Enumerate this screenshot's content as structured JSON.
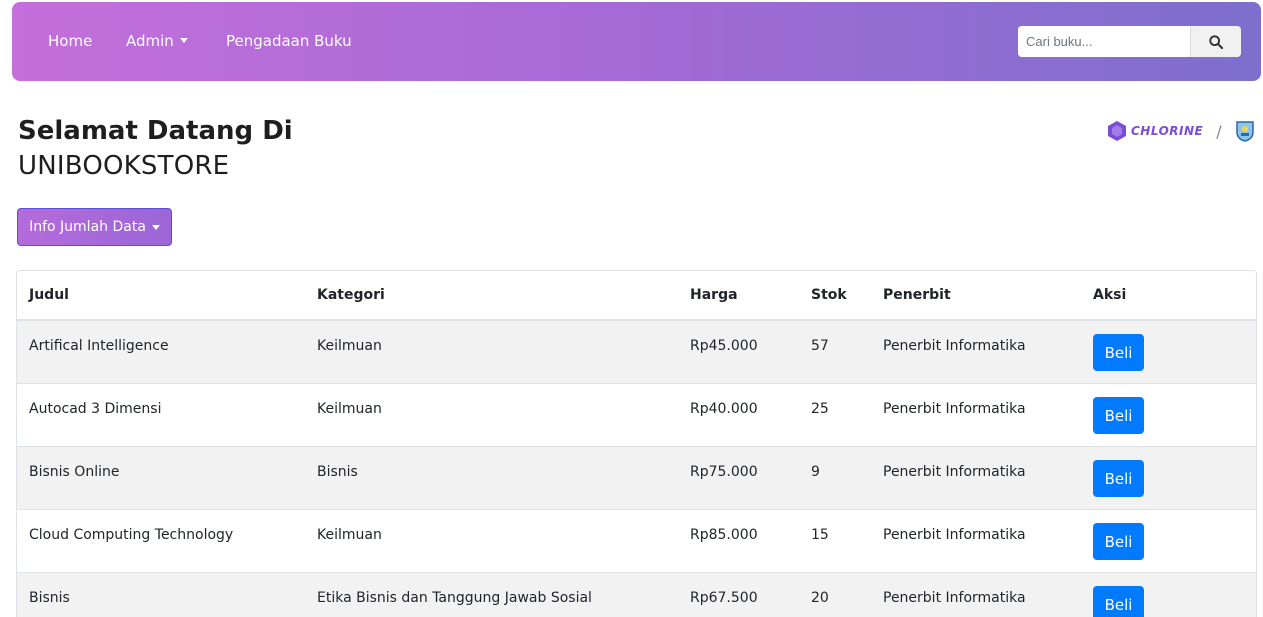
{
  "navbar": {
    "items": [
      {
        "label": "Home"
      },
      {
        "label": "Admin"
      },
      {
        "label": "Pengadaan Buku"
      }
    ],
    "search": {
      "placeholder": "Cari buku..."
    }
  },
  "header": {
    "title_line1": "Selamat Datang Di",
    "title_line2": "UNIBOOKSTORE",
    "logo_text": "CHLORINE",
    "separator": "/"
  },
  "info_button": {
    "label": "Info Jumlah Data"
  },
  "table": {
    "columns": [
      "Judul",
      "Kategori",
      "Harga",
      "Stok",
      "Penerbit",
      "Aksi"
    ],
    "rows": [
      {
        "judul": "Artifical Intelligence",
        "kategori": "Keilmuan",
        "harga": "Rp45.000",
        "stok": "57",
        "penerbit": "Penerbit Informatika",
        "aksi": "Beli"
      },
      {
        "judul": "Autocad 3 Dimensi",
        "kategori": "Keilmuan",
        "harga": "Rp40.000",
        "stok": "25",
        "penerbit": "Penerbit Informatika",
        "aksi": "Beli"
      },
      {
        "judul": "Bisnis Online",
        "kategori": "Bisnis",
        "harga": "Rp75.000",
        "stok": "9",
        "penerbit": "Penerbit Informatika",
        "aksi": "Beli"
      },
      {
        "judul": "Cloud Computing Technology",
        "kategori": "Keilmuan",
        "harga": "Rp85.000",
        "stok": "15",
        "penerbit": "Penerbit Informatika",
        "aksi": "Beli"
      },
      {
        "judul": "Bisnis",
        "kategori": "Etika Bisnis dan Tanggung Jawab Sosial",
        "harga": "Rp67.500",
        "stok": "20",
        "penerbit": "Penerbit Informatika",
        "aksi": "Beli"
      }
    ]
  },
  "icons": {
    "search": "search-icon",
    "logo": "chlorine-logo-icon",
    "emblem": "university-emblem-icon"
  },
  "colors": {
    "primary": "#007bff",
    "nav_start": "#c46fdb",
    "nav_end": "#7d6fcd"
  }
}
